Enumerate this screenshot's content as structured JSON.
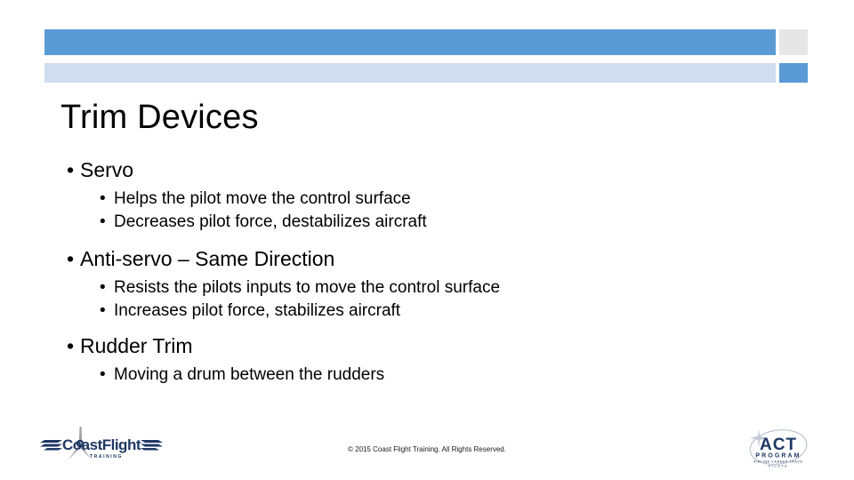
{
  "slide": {
    "title": "Trim Devices",
    "theme": {
      "accent_blue": "#5B9BD5",
      "light_blue": "#D0DCEF",
      "light_gray": "#E6E6E6",
      "text_color": "#000000",
      "logo_navy": "#1F3864",
      "logo_gray": "#A6A6A6"
    }
  },
  "content": {
    "groups": [
      {
        "heading": "Servo",
        "bullet": "•",
        "subitems": [
          "Helps the pilot move the control surface",
          "Decreases pilot force, destabilizes aircraft"
        ]
      },
      {
        "heading": "Anti-servo – Same Direction",
        "bullet": "•",
        "subitems": [
          "Resists the pilots inputs to move the control surface",
          "Increases pilot force, stabilizes aircraft"
        ]
      },
      {
        "heading": "Rudder Trim",
        "bullet": "•",
        "subitems": [
          "Moving a drum between the rudders"
        ]
      }
    ]
  },
  "footer": {
    "copyright": "© 2015 Coast Flight Training. All Rights Reserved.",
    "left_logo": {
      "name": "coast-flight-training-logo",
      "word_one": "C",
      "word_two": "oast",
      "word_three": "Flight",
      "tagline": "T R A I N I N G"
    },
    "right_logo": {
      "name": "act-program-logo",
      "title": "ACT",
      "subtitle": "PROGRAM",
      "tagline_line1": "AIRLINE CAREER TRACK",
      "tagline_line2": "PILOTS"
    }
  }
}
